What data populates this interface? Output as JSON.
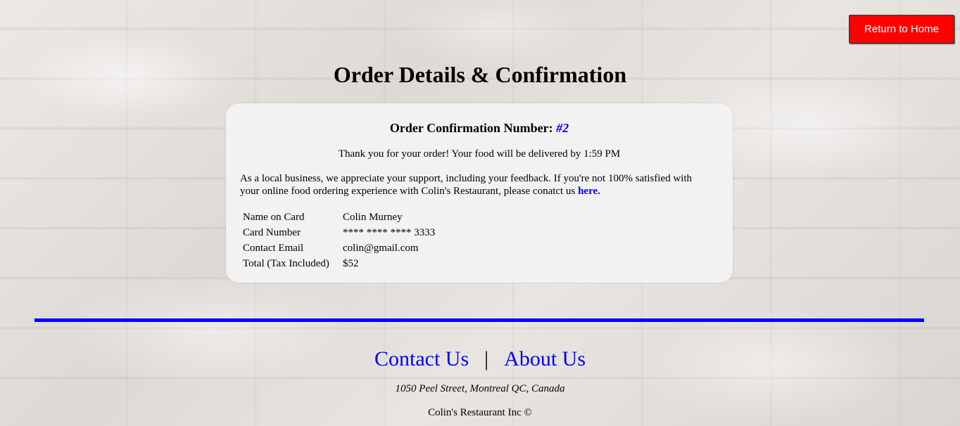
{
  "header": {
    "return_home_label": "Return to Home"
  },
  "page": {
    "title": "Order Details & Confirmation"
  },
  "confirmation": {
    "heading_label": "Order Confirmation Number:",
    "number": "#2",
    "thank_you": "Thank you for your order! Your food will be delivered by 1:59 PM",
    "feedback_text": "As a local business, we appreciate your support, including your feedback. If you're not 100% satisfied with your online food ordering experience with Colin's Restaurant, please conatct us",
    "feedback_link": "here."
  },
  "details": {
    "rows": [
      {
        "label": "Name on Card",
        "value": "Colin Murney"
      },
      {
        "label": "Card Number",
        "value": "**** **** **** 3333"
      },
      {
        "label": "Contact Email",
        "value": "colin@gmail.com"
      },
      {
        "label": "Total (Tax Included)",
        "value": "$52"
      }
    ]
  },
  "footer": {
    "contact_label": "Contact Us",
    "separator": "|",
    "about_label": "About Us",
    "address": "1050 Peel Street, Montreal QC, Canada",
    "copyright": "Colin's Restaurant Inc ©"
  },
  "colors": {
    "accent_blue": "#0000ff",
    "home_button": "#ff0000",
    "card_background": "#f2f2f2"
  }
}
